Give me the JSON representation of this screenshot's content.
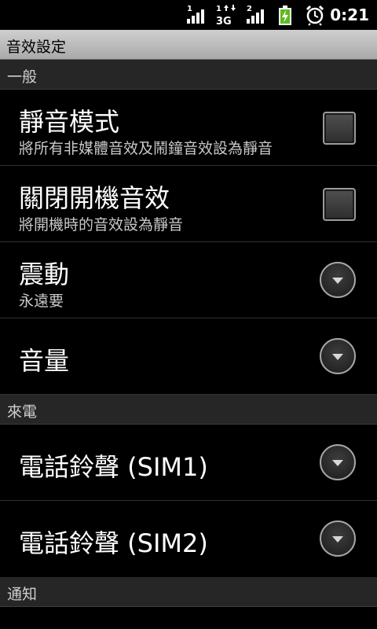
{
  "status_bar": {
    "sim1_label": "1",
    "sim2_label": "1",
    "network_type": "3G",
    "sim3_label": "2",
    "time": "0:21",
    "icons": [
      "signal-icon",
      "3g-data-icon",
      "signal-icon",
      "battery-charging-icon",
      "alarm-clock-icon"
    ]
  },
  "title": "音效設定",
  "sections": [
    {
      "header": "一般",
      "items": [
        {
          "title": "靜音模式",
          "summary": "將所有非媒體音效及鬧鐘音效設為靜音",
          "widget": "checkbox",
          "checked": false
        },
        {
          "title": "關閉開機音效",
          "summary": "將開機時的音效設為靜音",
          "widget": "checkbox",
          "checked": false
        },
        {
          "title": "震動",
          "summary": "永遠要",
          "widget": "dropdown"
        },
        {
          "title": "音量",
          "widget": "dropdown"
        }
      ]
    },
    {
      "header": "來電",
      "items": [
        {
          "title": "電話鈴聲 (SIM1)",
          "widget": "dropdown"
        },
        {
          "title": "電話鈴聲 (SIM2)",
          "widget": "dropdown"
        }
      ]
    },
    {
      "header": "通知",
      "items": []
    }
  ]
}
